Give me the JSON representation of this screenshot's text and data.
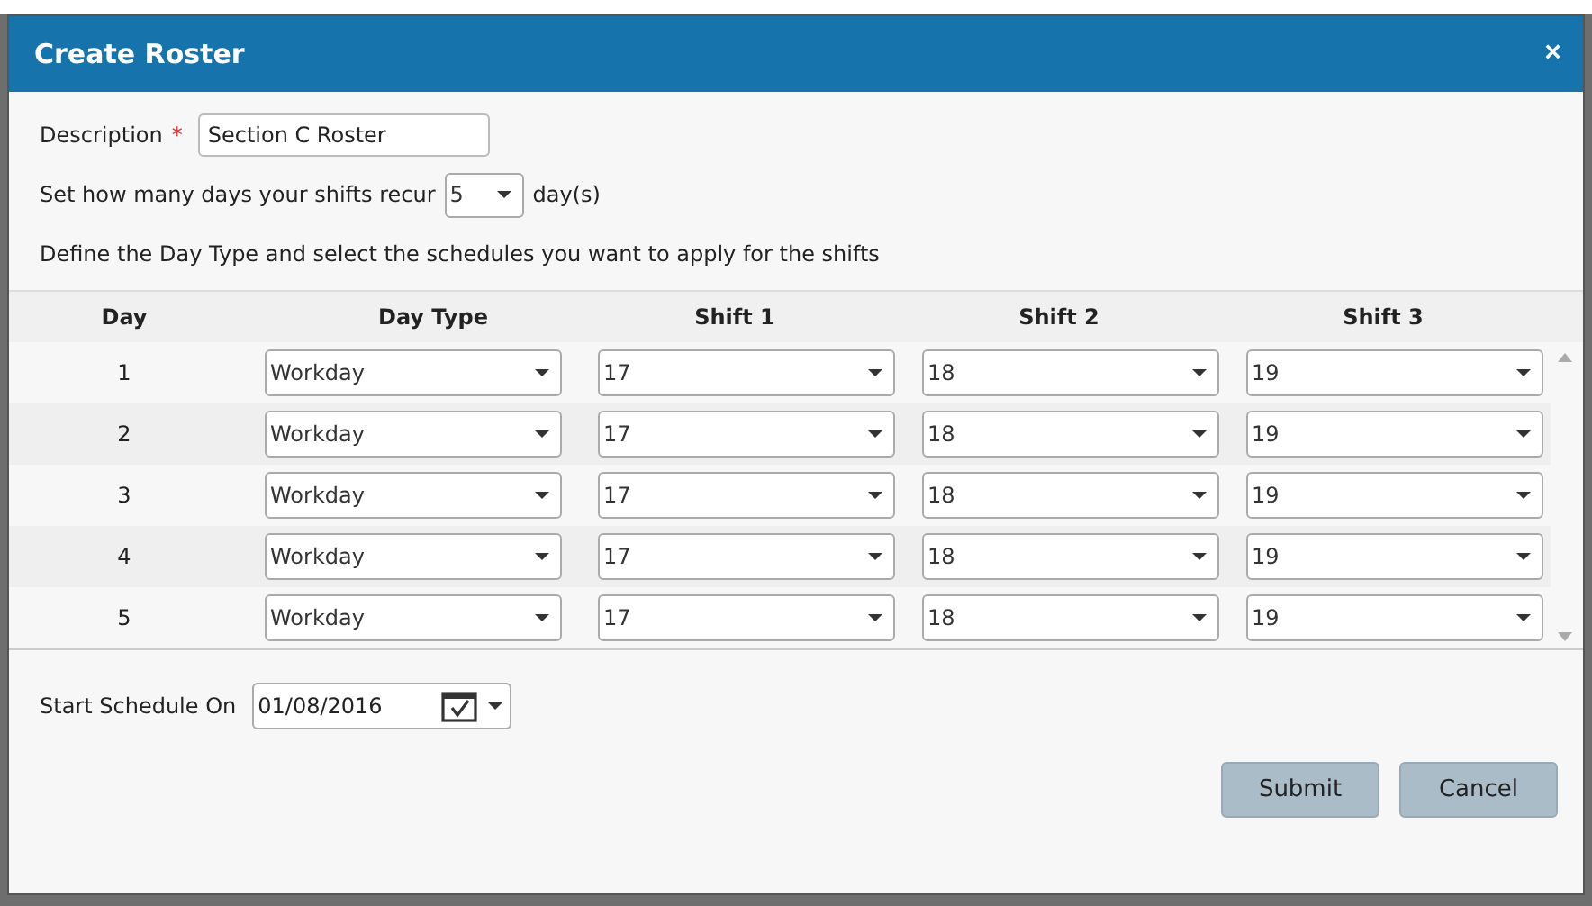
{
  "dialog": {
    "title": "Create Roster",
    "close": "×"
  },
  "description": {
    "label": "Description",
    "required": "*",
    "value": "Section C Roster"
  },
  "recur": {
    "label": "Set how many days your shifts recur",
    "value": "5",
    "unit": "day(s)"
  },
  "instruction": "Define the Day Type and select the schedules you want to apply for the shifts",
  "table": {
    "columns": [
      "Day",
      "Day Type",
      "Shift 1",
      "Shift 2",
      "Shift 3"
    ],
    "rows": [
      {
        "day": "1",
        "day_type": "Workday",
        "shifts": [
          "17",
          "18",
          "19"
        ]
      },
      {
        "day": "2",
        "day_type": "Workday",
        "shifts": [
          "17",
          "18",
          "19"
        ]
      },
      {
        "day": "3",
        "day_type": "Workday",
        "shifts": [
          "17",
          "18",
          "19"
        ]
      },
      {
        "day": "4",
        "day_type": "Workday",
        "shifts": [
          "17",
          "18",
          "19"
        ]
      },
      {
        "day": "5",
        "day_type": "Workday",
        "shifts": [
          "17",
          "18",
          "19"
        ]
      }
    ]
  },
  "start": {
    "label": "Start Schedule On",
    "value": "01/08/2016"
  },
  "buttons": [
    "Submit",
    "Cancel"
  ]
}
